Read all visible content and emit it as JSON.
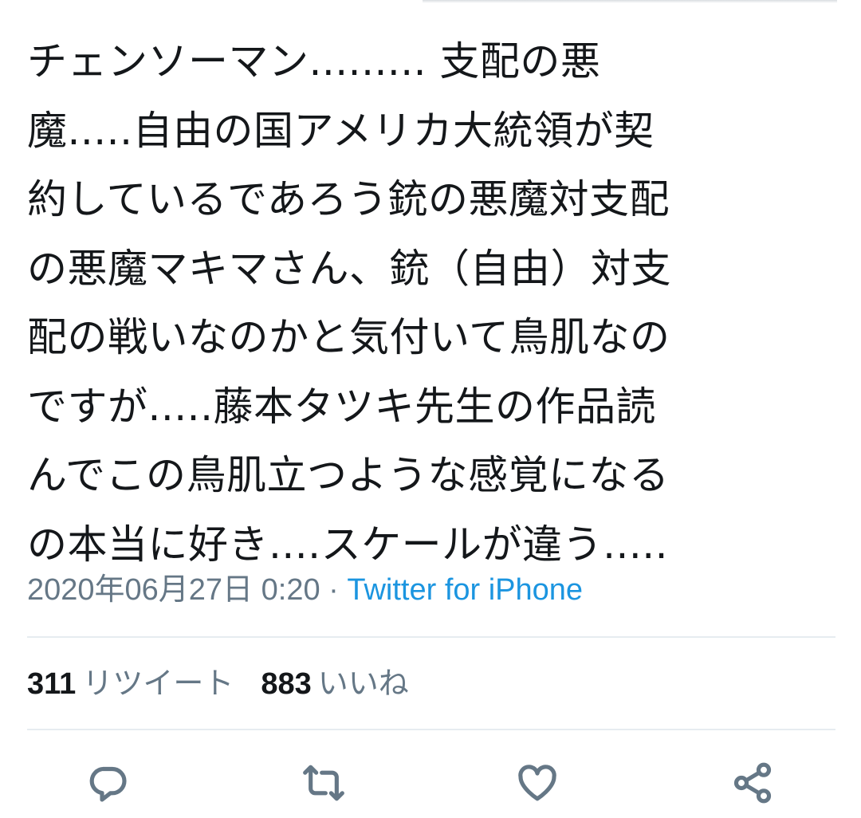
{
  "tweet": {
    "lines": [
      "チェンソーマン......... 支配の悪",
      "魔.....自由の国アメリカ大統領が契",
      "約しているであろう銃の悪魔対支配",
      "の悪魔マキマさん、銃（自由）対支",
      "配の戦いなのかと気付いて鳥肌なの",
      "ですが.....藤本タツキ先生の作品読",
      "んでこの鳥肌立つような感覚になる",
      "の本当に好き....スケールが違う....."
    ]
  },
  "meta": {
    "timestamp": "2020年06月27日 0:20",
    "separator": " · ",
    "source": "Twitter for iPhone"
  },
  "stats": {
    "retweets": {
      "count": "311",
      "label": "リツイート"
    },
    "likes": {
      "count": "883",
      "label": "いいね"
    }
  },
  "actions": [
    {
      "name": "reply",
      "icon": "reply-icon"
    },
    {
      "name": "retweet",
      "icon": "retweet-icon"
    },
    {
      "name": "like",
      "icon": "heart-icon"
    },
    {
      "name": "share",
      "icon": "share-icon"
    }
  ],
  "colors": {
    "text": "#14171a",
    "secondary": "#657786",
    "link": "#1b95e0",
    "divider": "#e6ecf0"
  }
}
